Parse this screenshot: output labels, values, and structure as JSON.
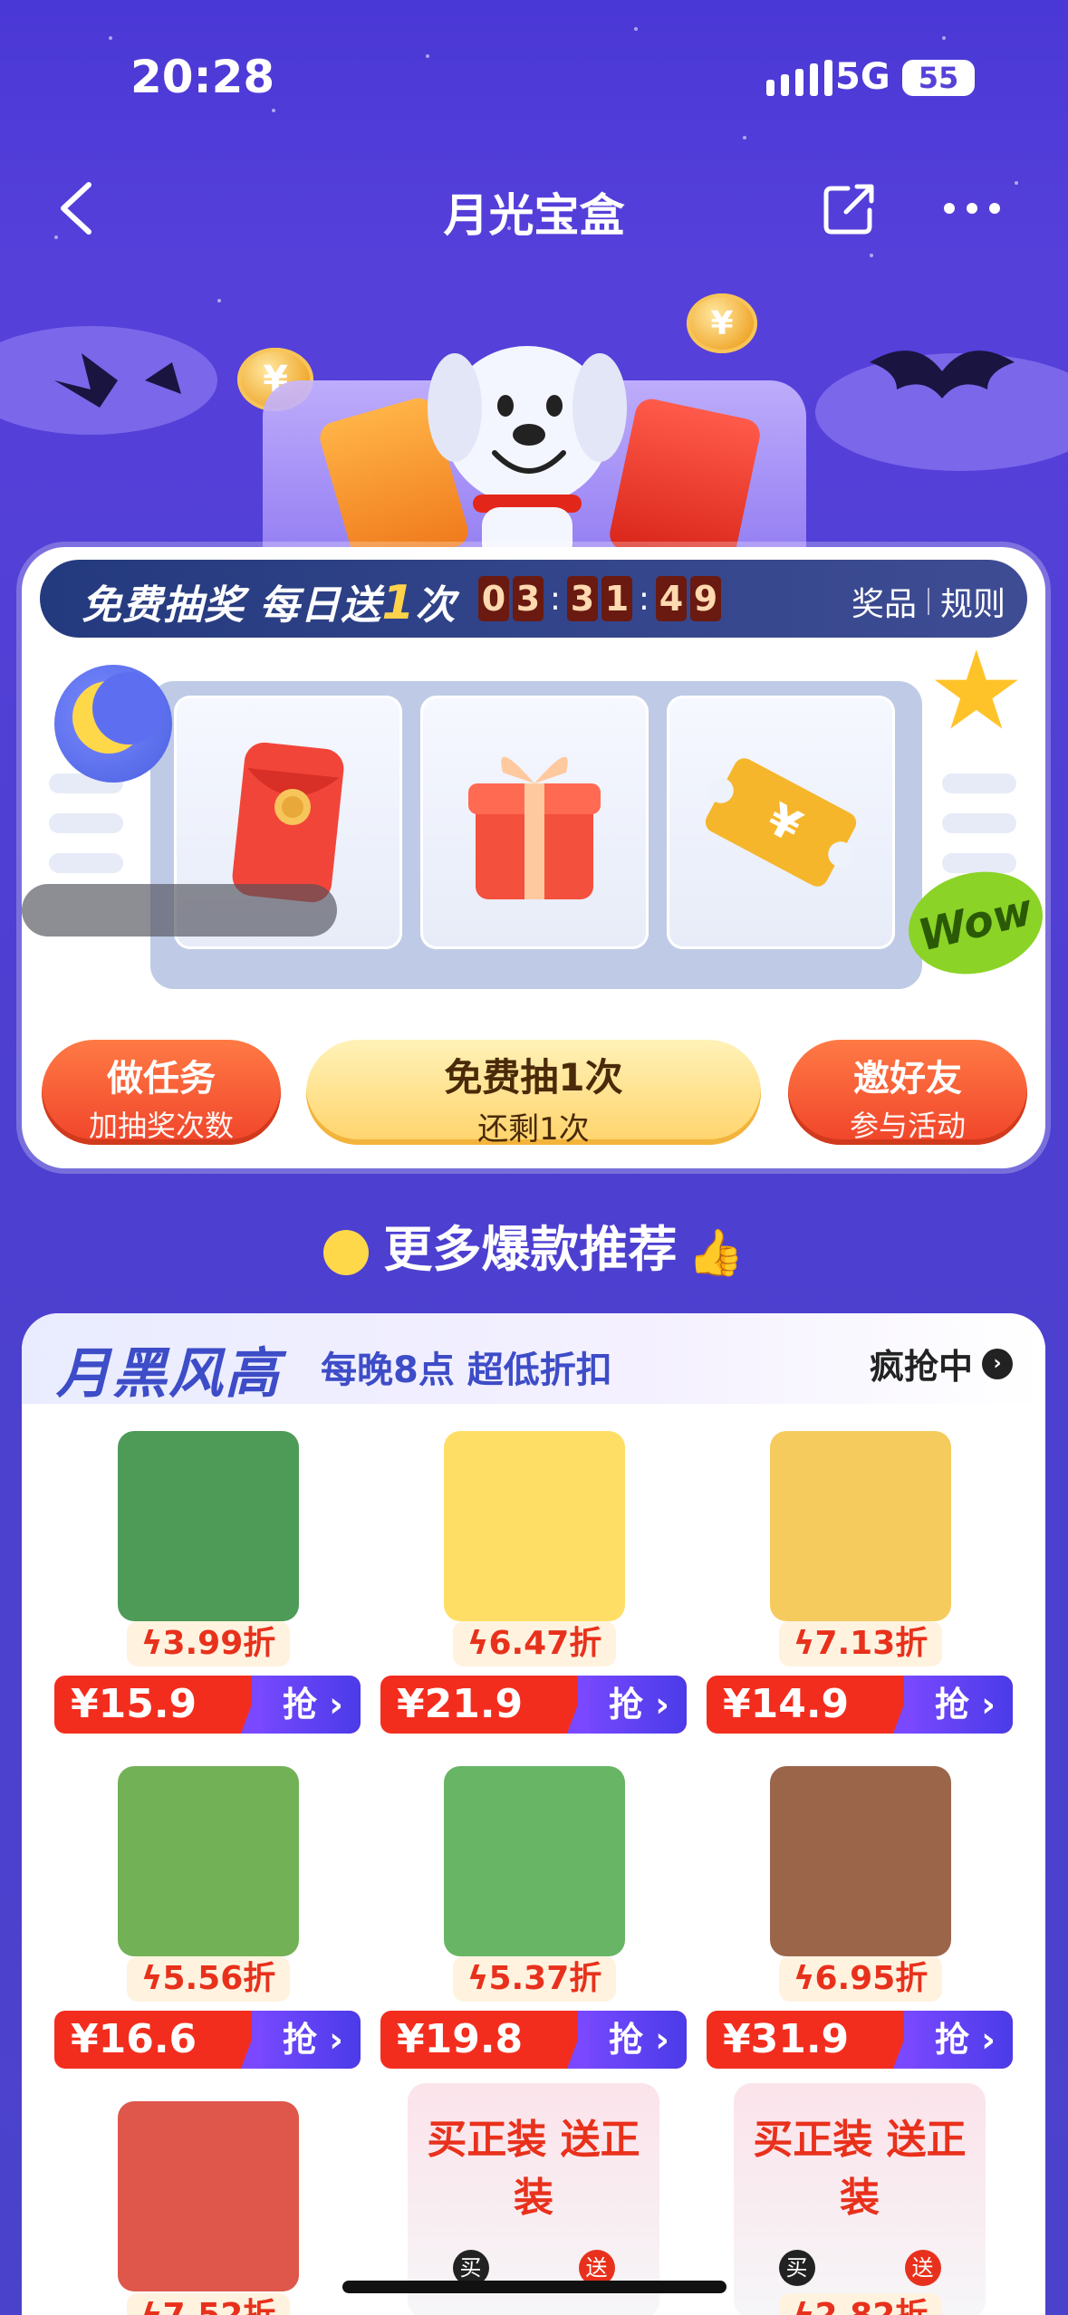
{
  "status": {
    "time": "20:28",
    "network": "5G",
    "battery": "55"
  },
  "nav": {
    "title": "月光宝盒"
  },
  "lottery": {
    "banner_prefix": "免费抽奖 每日送",
    "banner_count": "1",
    "banner_suffix": "次",
    "countdown": [
      "0",
      "3",
      "3",
      "1",
      "4",
      "9"
    ],
    "prizes_label": "奖品",
    "rules_label": "规则",
    "slots": [
      "red-envelope",
      "gift-box",
      "coupon"
    ],
    "wow": "Wow",
    "task_button": {
      "title": "做任务",
      "sub": "加抽奖次数"
    },
    "draw_button": {
      "title": "免费抽1次",
      "sub": "还剩1次"
    },
    "invite_button": {
      "title": "邀好友",
      "sub": "参与活动"
    }
  },
  "section": {
    "title": "更多爆款推荐"
  },
  "deals": {
    "logo": "月黑风高",
    "subtitle": "每晚8点 超低折扣",
    "cta": "疯抢中",
    "grab_label": "抢",
    "products": [
      {
        "discount": "3.99折",
        "price": "¥15.9",
        "name": "milo-biscuits",
        "color": "#2e8a3a"
      },
      {
        "discount": "6.47折",
        "price": "¥21.9",
        "name": "potato-sticks",
        "color": "#ffd84a"
      },
      {
        "discount": "7.13折",
        "price": "¥14.9",
        "name": "rice-cracker",
        "color": "#f3c242"
      },
      {
        "discount": "5.56折",
        "price": "¥16.6",
        "name": "seaweed-snack",
        "color": "#5aa33a"
      },
      {
        "discount": "5.37折",
        "price": "¥19.8",
        "name": "soda-crackers",
        "color": "#4ea84a"
      },
      {
        "discount": "6.95折",
        "price": "¥31.9",
        "name": "wannianqing-biscuits",
        "color": "#8a4a2a"
      },
      {
        "discount": "7.52折",
        "price": "",
        "name": "walnut-cookies",
        "color": "#d83a2a"
      },
      {
        "discount": "",
        "price": "",
        "name": "buy-get-free-promo",
        "color": "#f0c8d0"
      },
      {
        "discount": "2.82折",
        "price": "",
        "name": "buy-get-free-promo-2",
        "color": "#f0c8d0"
      }
    ],
    "promo_text": "买正装 送正装",
    "promo_buy": "买",
    "promo_gift": "送"
  }
}
